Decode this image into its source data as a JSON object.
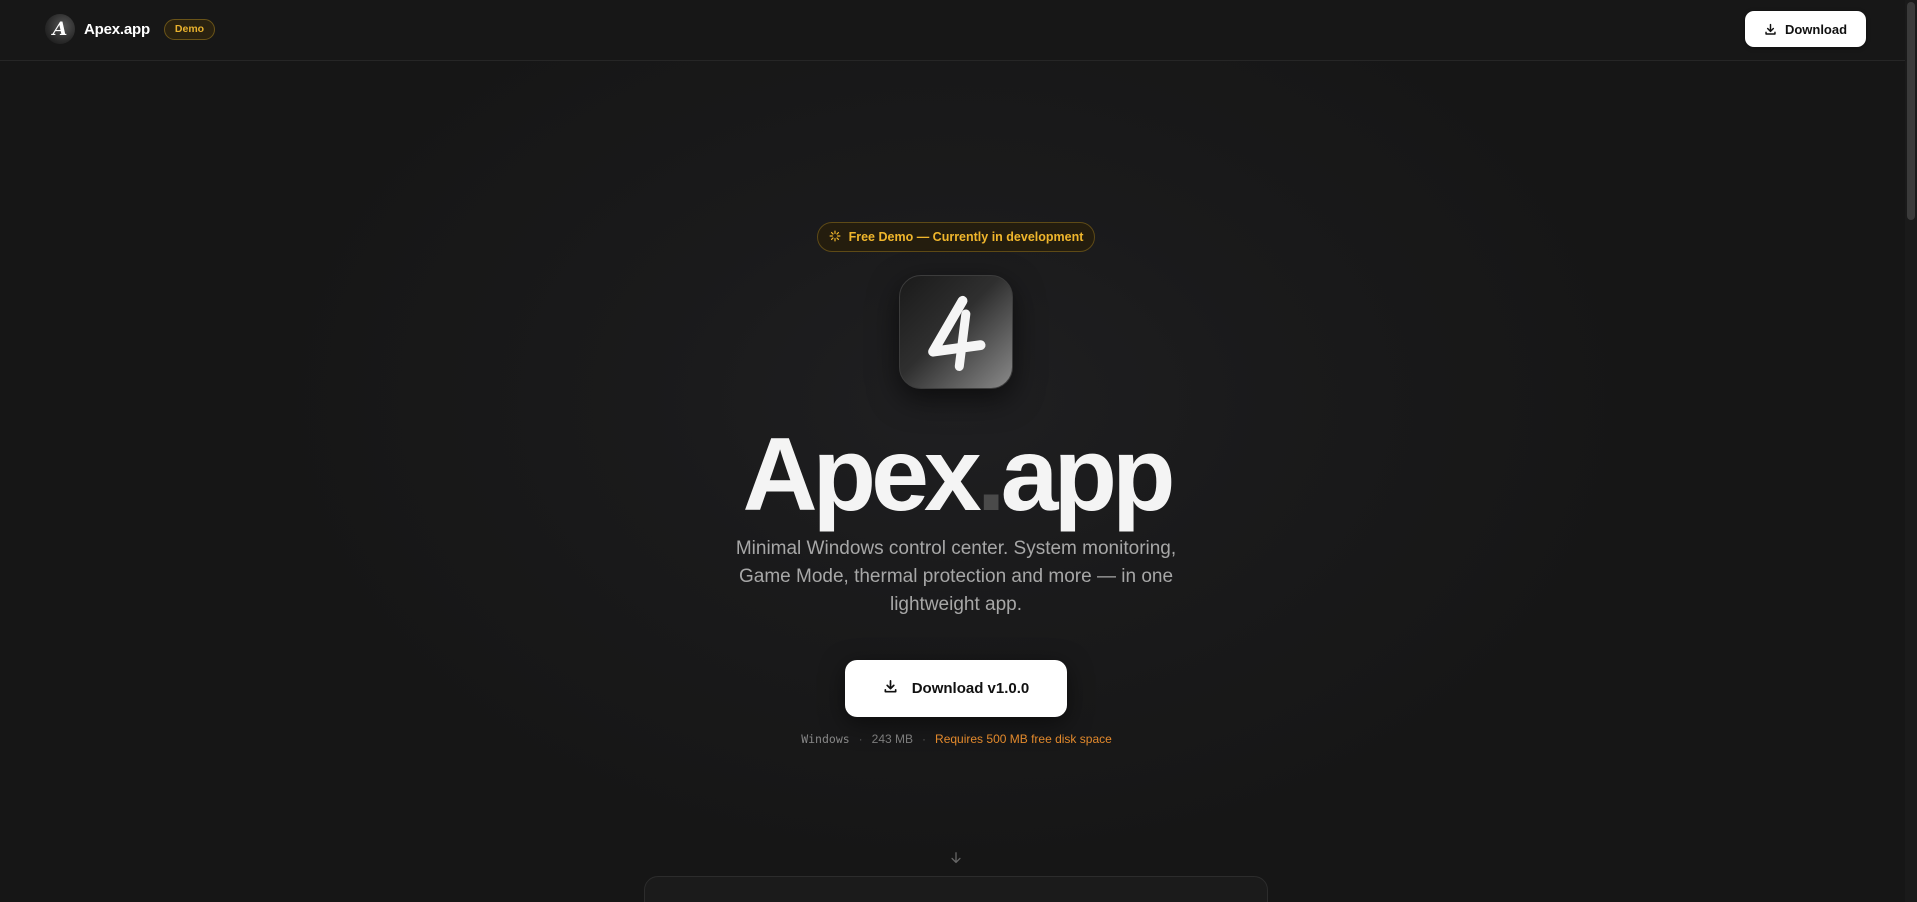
{
  "nav": {
    "brand_logo_letter": "A",
    "brand_name": "Apex.app",
    "badge": "Demo",
    "download_label": "Download"
  },
  "hero": {
    "pill_text": "Free Demo — Currently in development",
    "icon_letter": "A",
    "title_main": "Apex",
    "title_dot": ".",
    "title_suffix": "app",
    "subtitle": "Minimal Windows control center. System monitoring, Game Mode, thermal protection and more — in one lightweight app.",
    "download_label": "Download v1.0.0",
    "meta": {
      "platform": "Windows",
      "separator": "·",
      "size": "243 MB",
      "requirement": "Requires 500 MB free disk space"
    }
  },
  "colors": {
    "background": "#161616",
    "accent_gold": "#f0b62c",
    "warning_orange": "#e2892c",
    "button_bg": "#ffffff"
  },
  "icons": {
    "download": "download-icon",
    "sparkle": "sparkle-icon",
    "arrow_down": "arrow-down-icon"
  }
}
